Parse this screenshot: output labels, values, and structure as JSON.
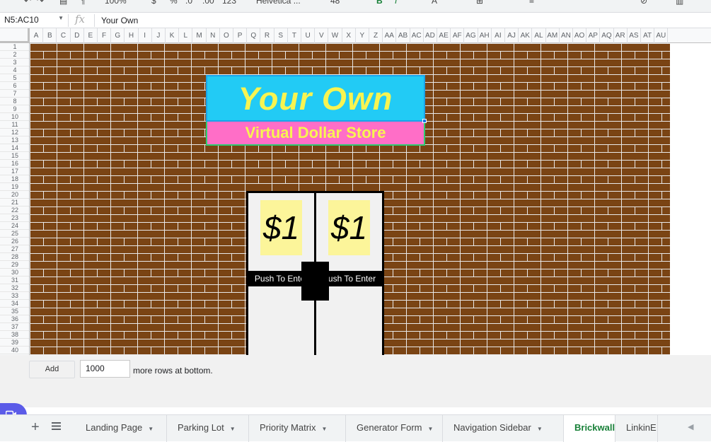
{
  "toolbar": {
    "zoom": "100%",
    "currency": "$",
    "percent": "%",
    "dec_less": ".0",
    "dec_more": ".00",
    "number_format": "123",
    "font": "Helvetica ...",
    "font_size": "48",
    "bold": "B",
    "italic": "I",
    "text_color": "A"
  },
  "formula_bar": {
    "name_box": "N5:AC10",
    "fx": "fx",
    "value": "Your Own"
  },
  "columns": [
    "A",
    "B",
    "C",
    "D",
    "E",
    "F",
    "G",
    "H",
    "I",
    "J",
    "K",
    "L",
    "M",
    "N",
    "O",
    "P",
    "Q",
    "R",
    "S",
    "T",
    "U",
    "V",
    "W",
    "X",
    "Y",
    "Z",
    "AA",
    "AB",
    "AC",
    "AD",
    "AE",
    "AF",
    "AG",
    "AH",
    "AI",
    "AJ",
    "AK",
    "AL",
    "AM",
    "AN",
    "AO",
    "AP",
    "AQ",
    "AR",
    "AS",
    "AT",
    "AU"
  ],
  "rows": [
    "1",
    "2",
    "3",
    "4",
    "5",
    "6",
    "7",
    "8",
    "9",
    "10",
    "11",
    "12",
    "13",
    "14",
    "15",
    "16",
    "17",
    "18",
    "19",
    "20",
    "21",
    "22",
    "23",
    "24",
    "25",
    "26",
    "27",
    "28",
    "29",
    "30",
    "31",
    "32",
    "33",
    "34",
    "35",
    "36",
    "37",
    "38",
    "39",
    "40"
  ],
  "sign": {
    "title": "Your Own",
    "subtitle": "Virtual Dollar Store"
  },
  "doors": {
    "left_price": "$1",
    "right_price": "$1",
    "left_label": "Push To Enter",
    "right_label": "Push To Enter"
  },
  "add_rows": {
    "button": "Add",
    "count": "1000",
    "suffix": "more rows at bottom."
  },
  "tabs": [
    {
      "label": "Landing Page",
      "active": false
    },
    {
      "label": "Parking Lot",
      "active": false
    },
    {
      "label": "Priority Matrix",
      "active": false
    },
    {
      "label": "Generator Form",
      "active": false
    },
    {
      "label": "Navigation Sidebar",
      "active": false
    },
    {
      "label": "Brickwall",
      "active": true
    },
    {
      "label": "LinkinE",
      "active": false
    }
  ],
  "colors": {
    "brick": "#7a4414",
    "mortar": "#e9e9e9",
    "sign_blue": "#22cbf5",
    "sign_pink": "#ff6ec7",
    "sign_text": "#f7f451",
    "price_bg": "#fcf59a",
    "active_tab": "#188038"
  }
}
